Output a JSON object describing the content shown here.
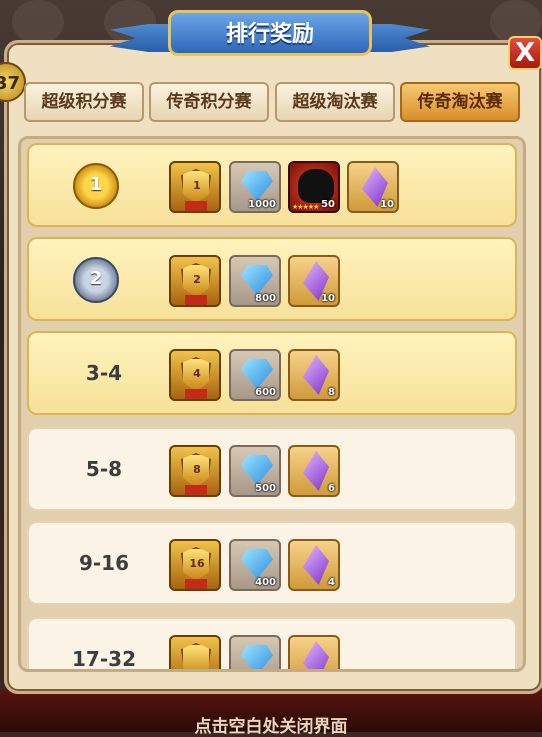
{
  "title": "排行奖励",
  "close_label": "X",
  "level_badge": "37",
  "tabs": [
    {
      "label": "超级积分赛",
      "active": false
    },
    {
      "label": "传奇积分赛",
      "active": false
    },
    {
      "label": "超级淘汰赛",
      "active": false
    },
    {
      "label": "传奇淘汰赛",
      "active": true
    }
  ],
  "ranks": [
    {
      "rank": "1",
      "style": "gold-medal",
      "trophy_label": "1",
      "rewards": [
        {
          "type": "gem",
          "count": "1000"
        },
        {
          "type": "hero",
          "count": "50"
        },
        {
          "type": "crystal",
          "count": "10"
        }
      ]
    },
    {
      "rank": "2",
      "style": "silver-medal",
      "trophy_label": "2",
      "rewards": [
        {
          "type": "gem",
          "count": "800"
        },
        {
          "type": "crystal",
          "count": "10"
        }
      ]
    },
    {
      "rank": "3-4",
      "style": "text",
      "trophy_label": "4",
      "rewards": [
        {
          "type": "gem",
          "count": "600"
        },
        {
          "type": "crystal",
          "count": "8"
        }
      ]
    },
    {
      "rank": "5-8",
      "style": "text",
      "trophy_label": "8",
      "rewards": [
        {
          "type": "gem",
          "count": "500"
        },
        {
          "type": "crystal",
          "count": "6"
        }
      ]
    },
    {
      "rank": "9-16",
      "style": "text",
      "trophy_label": "16",
      "rewards": [
        {
          "type": "gem",
          "count": "400"
        },
        {
          "type": "crystal",
          "count": "4"
        }
      ]
    },
    {
      "rank": "17-32",
      "style": "text",
      "trophy_label": "",
      "rewards": [
        {
          "type": "gem",
          "count": ""
        },
        {
          "type": "crystal",
          "count": ""
        }
      ]
    }
  ],
  "footer_hint": "点击空白处关闭界面"
}
